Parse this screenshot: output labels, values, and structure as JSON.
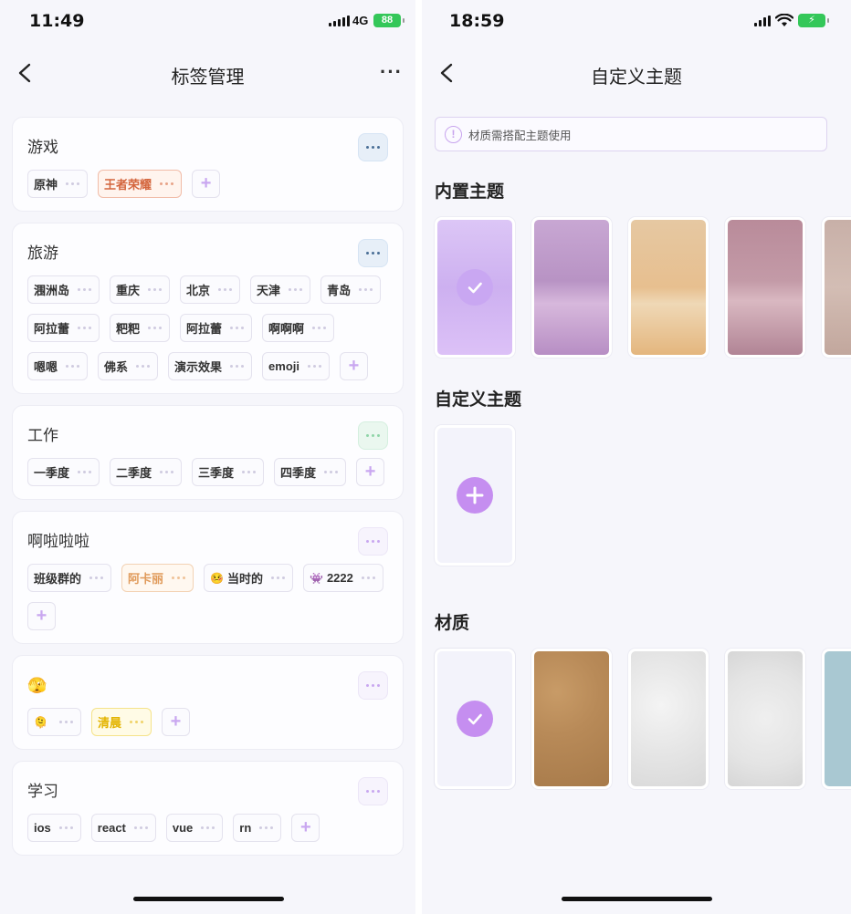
{
  "left": {
    "status": {
      "time": "11:49",
      "network": "4G",
      "battery": "88"
    },
    "nav": {
      "title": "标签管理"
    },
    "groups": [
      {
        "title": "游戏",
        "more_color": "blue",
        "tags": [
          {
            "label": "原神"
          },
          {
            "label": "王者荣耀",
            "style": "orange"
          }
        ]
      },
      {
        "title": "旅游",
        "more_color": "blue",
        "tags": [
          {
            "label": "涠洲岛"
          },
          {
            "label": "重庆"
          },
          {
            "label": "北京"
          },
          {
            "label": "天津"
          },
          {
            "label": "青岛"
          },
          {
            "label": "阿拉蕾"
          },
          {
            "label": "粑粑"
          },
          {
            "label": "阿拉蕾"
          },
          {
            "label": "啊啊啊"
          },
          {
            "label": "嗯嗯"
          },
          {
            "label": "佛系"
          },
          {
            "label": "演示效果"
          },
          {
            "label": "emoji"
          }
        ]
      },
      {
        "title": "工作",
        "more_color": "green",
        "tags": [
          {
            "label": "一季度"
          },
          {
            "label": "二季度"
          },
          {
            "label": "三季度"
          },
          {
            "label": "四季度"
          }
        ]
      },
      {
        "title": "啊啦啦啦",
        "more_color": "purple",
        "tags": [
          {
            "label": "班级群的"
          },
          {
            "label": "阿卡丽",
            "style": "peach"
          },
          {
            "label": "当时的",
            "emoji": "🤒"
          },
          {
            "label": "2222",
            "emoji": "👾"
          }
        ]
      },
      {
        "title": "🫣",
        "more_color": "purple",
        "tags": [
          {
            "label": "",
            "emoji": "🫠"
          },
          {
            "label": "清晨",
            "style": "yellow"
          }
        ]
      },
      {
        "title": "学习",
        "more_color": "purple",
        "tags": [
          {
            "label": "ios"
          },
          {
            "label": "react"
          },
          {
            "label": "vue"
          },
          {
            "label": "rn"
          }
        ]
      }
    ]
  },
  "right": {
    "status": {
      "time": "18:59"
    },
    "nav": {
      "title": "自定义主题"
    },
    "notice": "材质需搭配主题使用",
    "sections": {
      "builtin": "内置主题",
      "custom": "自定义主题",
      "material": "材质"
    },
    "builtin_themes": [
      {
        "name": "theme-lavender",
        "selected": true
      },
      {
        "name": "theme-purple"
      },
      {
        "name": "theme-apricot"
      },
      {
        "name": "theme-rose"
      },
      {
        "name": "theme-taupe"
      }
    ],
    "materials": [
      {
        "name": "material-none",
        "selected": true
      },
      {
        "name": "material-kraft-paper"
      },
      {
        "name": "material-white-paper"
      },
      {
        "name": "material-grey-paper"
      },
      {
        "name": "material-blue"
      }
    ]
  },
  "colors": {
    "accent": "#c58ef0",
    "background": "#f6f6fb"
  }
}
